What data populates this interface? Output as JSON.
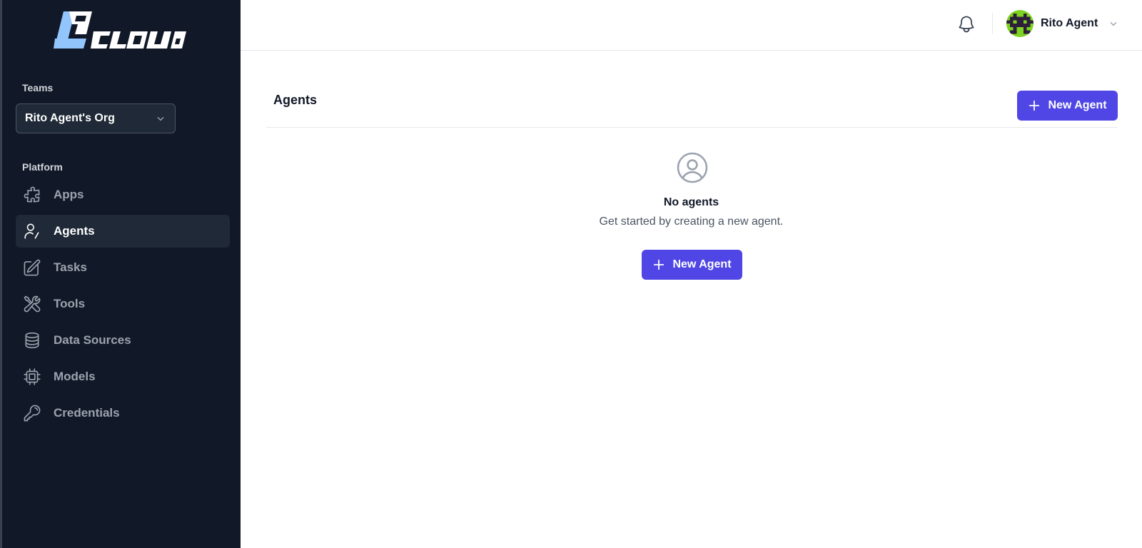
{
  "brand": {
    "logo_text": "LGCLOUD",
    "icon": "logo-icon"
  },
  "sidebar": {
    "teams_label": "Teams",
    "team_select": {
      "value": "Rito Agent's Org",
      "icon": "chevron-down-icon"
    },
    "platform_label": "Platform",
    "items": [
      {
        "label": "Apps",
        "icon": "puzzle-icon",
        "active": false
      },
      {
        "label": "Agents",
        "icon": "user-agent-icon",
        "active": true
      },
      {
        "label": "Tasks",
        "icon": "pencil-square-icon",
        "active": false
      },
      {
        "label": "Tools",
        "icon": "wrench-screwdriver-icon",
        "active": false
      },
      {
        "label": "Data Sources",
        "icon": "database-icon",
        "active": false
      },
      {
        "label": "Models",
        "icon": "cpu-chip-icon",
        "active": false
      },
      {
        "label": "Credentials",
        "icon": "key-icon",
        "active": false
      }
    ]
  },
  "header": {
    "notification_icon": "bell-icon",
    "user": {
      "name": "Rito Agent",
      "avatar_icon": "pixel-avatar",
      "menu_icon": "chevron-down-icon"
    }
  },
  "main": {
    "title": "Agents",
    "new_agent_label": "New Agent",
    "empty_state": {
      "icon": "user-circle-icon",
      "title": "No agents",
      "subtitle": "Get started by creating a new agent.",
      "button_label": "New Agent"
    }
  },
  "colors": {
    "sidebar_bg": "#111827",
    "sidebar_active_bg": "#1f2937",
    "primary": "#4f46e5",
    "logo_blue": "#93c5fd"
  }
}
